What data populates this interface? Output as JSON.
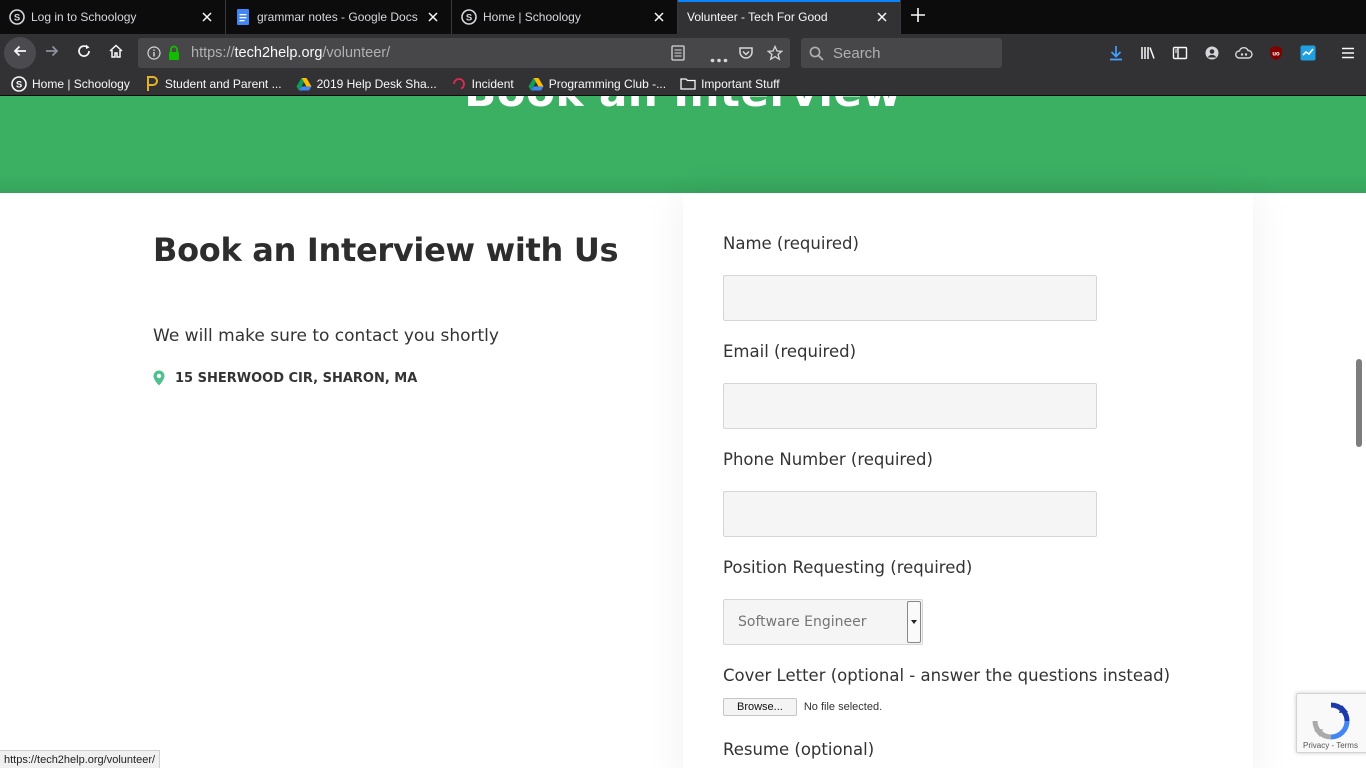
{
  "browser": {
    "tabs": [
      {
        "title": "Log in to Schoology",
        "icon": "schoology-icon",
        "active": false
      },
      {
        "title": "grammar notes - Google Docs",
        "icon": "google-docs-icon",
        "active": false
      },
      {
        "title": "Home | Schoology",
        "icon": "schoology-icon",
        "active": false
      },
      {
        "title": "Volunteer - Tech For Good",
        "icon": "",
        "active": true
      }
    ],
    "url": {
      "scheme": "https://",
      "host": "tech2help.org",
      "path": "/volunteer/"
    },
    "search_placeholder": "Search",
    "bookmarks": [
      {
        "label": "Home | Schoology",
        "icon": "schoology-icon"
      },
      {
        "label": "Student and Parent ...",
        "icon": "pearson-icon"
      },
      {
        "label": "2019 Help Desk Sha...",
        "icon": "google-drive-icon"
      },
      {
        "label": "Incident",
        "icon": "incident-icon"
      },
      {
        "label": "Programming Club -...",
        "icon": "google-drive-icon"
      },
      {
        "label": "Important Stuff",
        "icon": "folder-icon"
      }
    ],
    "status_url": "https://tech2help.org/volunteer/"
  },
  "hero": {
    "title": "Book an Interview"
  },
  "info": {
    "heading": "Book an Interview with Us",
    "subtext": "We will make sure to contact you shortly",
    "address": "15 SHERWOOD CIR, SHARON, MA"
  },
  "form": {
    "name_label": "Name (required)",
    "name_value": "",
    "email_label": "Email (required)",
    "email_value": "",
    "phone_label": "Phone Number (required)",
    "phone_value": "",
    "position_label": "Position Requesting (required)",
    "position_value": "Software Engineer",
    "cover_label": "Cover Letter (optional - answer the questions instead)",
    "browse_label": "Browse...",
    "no_file_text": "No file selected.",
    "resume_label": "Resume (optional)"
  },
  "recaptcha": {
    "terms": "Privacy - Terms"
  },
  "colors": {
    "hero_green": "#3bb063",
    "pin_green": "#4fc08d",
    "tab_accent": "#0a84ff"
  }
}
